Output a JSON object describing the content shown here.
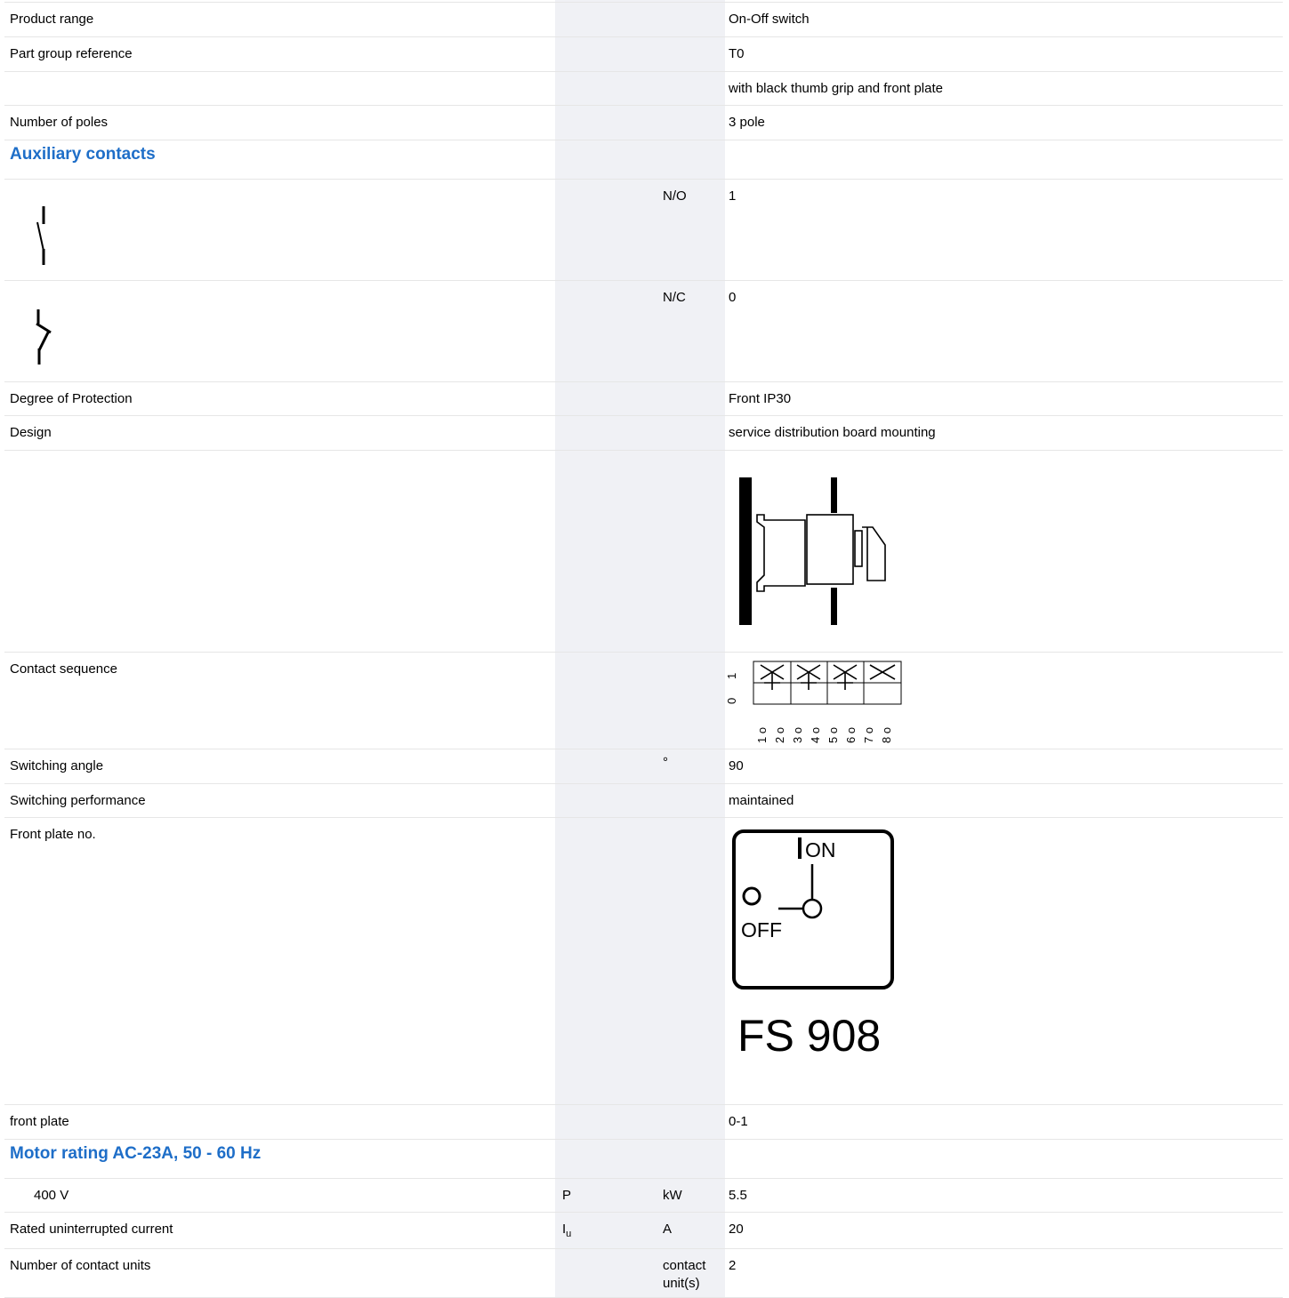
{
  "rows": {
    "product_range": {
      "label": "Product range",
      "value": "On-Off switch"
    },
    "part_group": {
      "label": "Part group reference",
      "value": "T0"
    },
    "grip": {
      "value": "with black thumb grip and front plate"
    },
    "poles": {
      "label": "Number of poles",
      "value": "3 pole"
    },
    "aux_heading": "Auxiliary contacts",
    "no": {
      "unit": "N/O",
      "value": "1",
      "icon": "normally-open-contact-icon"
    },
    "nc": {
      "unit": "N/C",
      "value": "0",
      "icon": "normally-closed-contact-icon"
    },
    "protection": {
      "label": "Degree of Protection",
      "value": "Front IP30"
    },
    "design": {
      "label": "Design",
      "value": "service distribution board mounting"
    },
    "contact_sequence": {
      "label": "Contact sequence",
      "positions": [
        "0",
        "1"
      ],
      "terminals": [
        "1 o",
        "2 o",
        "3 o",
        "4 o",
        "5 o",
        "6 o",
        "7 o",
        "8 o"
      ]
    },
    "switching_angle": {
      "label": "Switching angle",
      "unit": "°",
      "value": "90"
    },
    "switching_performance": {
      "label": "Switching performance",
      "value": "maintained"
    },
    "front_plate_no": {
      "label": "Front plate no.",
      "on_text": "ON",
      "off_text": "OFF",
      "plate_code": "FS 908"
    },
    "front_plate": {
      "label": "front plate",
      "value": "0-1"
    },
    "motor_heading": "Motor rating AC-23A, 50 - 60 Hz",
    "motor_400": {
      "label": "400 V",
      "symbol": "P",
      "unit": "kW",
      "value": "5.5"
    },
    "rated_current": {
      "label": "Rated uninterrupted current",
      "symbol": "I",
      "symbol_sub": "u",
      "unit": "A",
      "value": "20"
    },
    "contact_units": {
      "label": "Number of contact units",
      "unit": "contact unit(s)",
      "value": "2"
    }
  }
}
